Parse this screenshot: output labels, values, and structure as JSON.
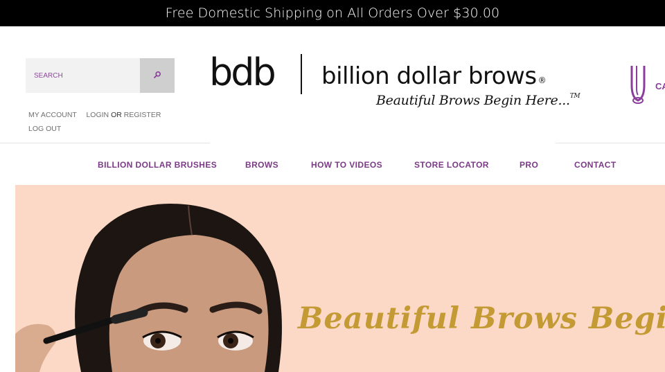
{
  "announcement": {
    "text": "Free Domestic Shipping on All Orders Over $30.00"
  },
  "search": {
    "placeholder": "SEARCH",
    "button_icon": "search-icon"
  },
  "account": {
    "my_account": "MY ACCOUNT",
    "login": "LOGIN",
    "or": "OR",
    "register": "REGISTER",
    "logout": "LOG OUT"
  },
  "logo": {
    "mark": "bdb",
    "wordmark": "billion dollar brows",
    "registered": "®",
    "tagline": "Beautiful Brows Begin Here...",
    "trademark": "TM"
  },
  "cart": {
    "label": "CA",
    "icon": "cart-icon"
  },
  "nav": {
    "items": [
      {
        "label": "BILLION DOLLAR BRUSHES"
      },
      {
        "label": "BROWS"
      },
      {
        "label": "HOW TO VIDEOS"
      },
      {
        "label": "STORE LOCATOR"
      },
      {
        "label": "PRO"
      },
      {
        "label": "CONTACT"
      }
    ]
  },
  "hero": {
    "tagline": "Beautiful Brows Begin Here."
  },
  "colors": {
    "announcement_bg": "#000000",
    "brand_purple": "#7a3a86",
    "hero_bg": "#fcd9c6",
    "hero_gold": "#c39a34"
  }
}
